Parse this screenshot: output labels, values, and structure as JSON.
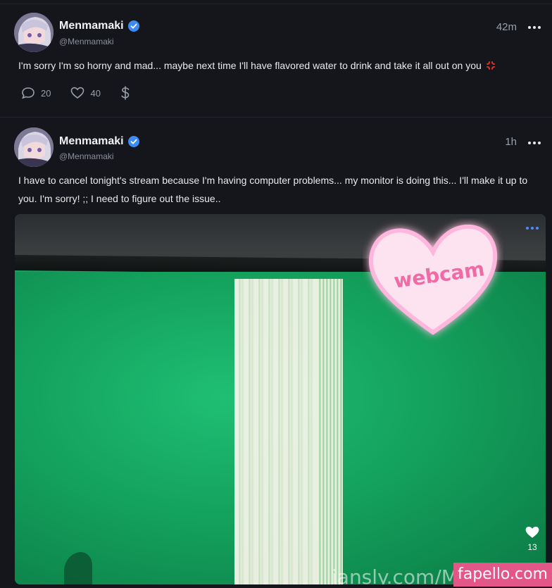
{
  "posts": [
    {
      "author": "Menmamaki",
      "handle": "@Menmamaki",
      "time": "42m",
      "text": "I'm sorry I'm so horny and mad... maybe next time I'll have flavored water to drink and take it all out on you",
      "emoji_icon": "anger-symbol-icon",
      "comments": "20",
      "likes": "40"
    },
    {
      "author": "Menmamaki",
      "handle": "@Menmamaki",
      "time": "1h",
      "text": "I have to cancel tonight's stream because I'm having computer problems... my monitor is doing this... I'll make it up to you. I'm sorry! ;; I need to figure out the issue..",
      "media": {
        "sticker_text": "webcam",
        "watermark": "iansly.com/Men",
        "likes": "13"
      }
    }
  ],
  "site_watermark": "fapello.com",
  "colors": {
    "background": "#14161b",
    "verified": "#3b8bf5",
    "accent": "#4d8dff",
    "screen_green": "#16a35f",
    "sticker_pink": "#f06aa6",
    "brand_pink": "#e25688"
  }
}
